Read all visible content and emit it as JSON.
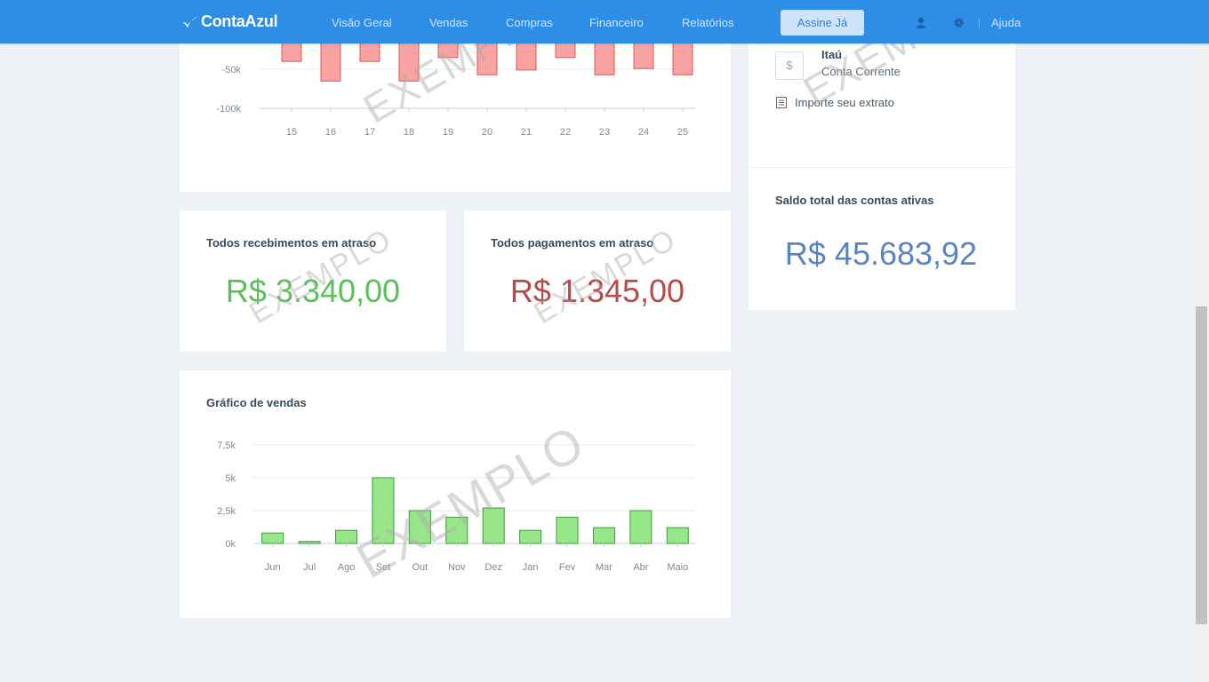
{
  "nav": {
    "brand": "ContaAzul",
    "items": [
      "Visão Geral",
      "Vendas",
      "Compras",
      "Financeiro",
      "Relatórios"
    ],
    "subscribe": "Assine Já",
    "help": "Ajuda"
  },
  "account": {
    "bank": "Itaú",
    "type": "Conta Corrente",
    "currency_symbol": "$",
    "import_link": "Importe seu extrato"
  },
  "balance": {
    "title": "Saldo total das contas ativas",
    "value": "R$ 45.683,92"
  },
  "receivables": {
    "title": "Todos recebimentos em atraso",
    "value": "R$ 3.340,00",
    "color": "#5cbf5c"
  },
  "payables": {
    "title": "Todos pagamentos em atraso",
    "value": "R$ 1.345,00",
    "color": "#b84a4a"
  },
  "watermark": "EXEMPLO",
  "chart_data": [
    {
      "type": "bar",
      "categories": [
        "15",
        "16",
        "17",
        "18",
        "19",
        "20",
        "21",
        "22",
        "23",
        "24",
        "25"
      ],
      "values": [
        -40000,
        -65000,
        -40000,
        -65000,
        -35000,
        -57000,
        -51000,
        -35000,
        -57000,
        -49000,
        -57000
      ],
      "yticks": [
        "-50k",
        "-100k"
      ],
      "ylim": [
        -100000,
        0
      ],
      "color": "#f9a3a3"
    },
    {
      "type": "bar",
      "title": "Gráfico de vendas",
      "categories": [
        "Jun",
        "Jul",
        "Ago",
        "Set",
        "Out",
        "Nov",
        "Dez",
        "Jan",
        "Fev",
        "Mar",
        "Abr",
        "Maio"
      ],
      "values": [
        800,
        150,
        1000,
        5000,
        2500,
        2000,
        2700,
        1000,
        2000,
        1200,
        2500,
        1200
      ],
      "yticks": [
        "0k",
        "2,5k",
        "5k",
        "7,5k"
      ],
      "ylim": [
        0,
        7500
      ],
      "color": "#97e689"
    }
  ]
}
